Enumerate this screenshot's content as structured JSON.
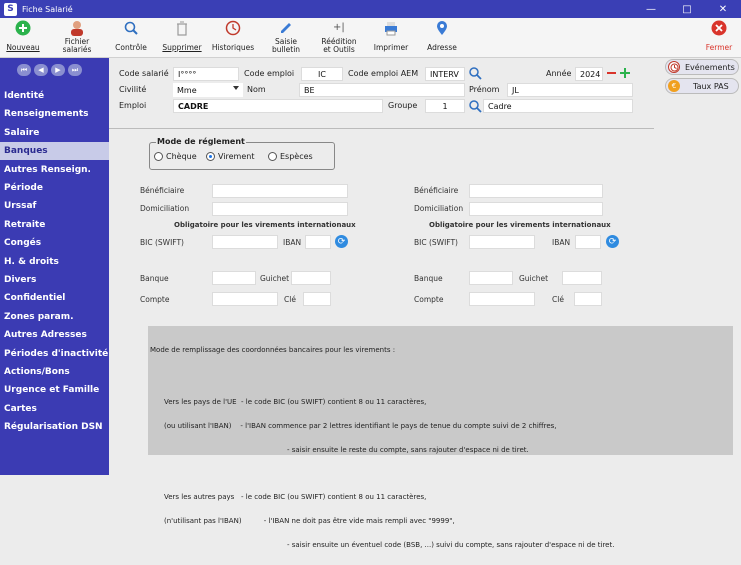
{
  "window": {
    "app_icon": "S",
    "title": "Fiche Salarié",
    "minimize": "—",
    "maximize": "□",
    "close": "✕"
  },
  "toolbar": {
    "nouveau": "Nouveau",
    "fichier_1": "Fichier",
    "fichier_2": "salariés",
    "controle": "Contrôle",
    "supprimer": "Supprimer",
    "historiques": "Historiques",
    "saisie_1": "Saisie",
    "saisie_2": "bulletin",
    "reedition_1": "Réédition",
    "reedition_2": "et Outils",
    "imprimer": "Imprimer",
    "adresse": "Adresse",
    "fermer": "Fermer"
  },
  "sidebar": {
    "items": [
      "Identité",
      "Renseignements",
      "Salaire",
      "Banques",
      "Autres Renseign.",
      "Période",
      "Urssaf",
      "Retraite",
      "Congés",
      "H. & droits",
      "Divers",
      "Confidentiel",
      "Zones param.",
      "Autres Adresses",
      "Périodes d'inactivité",
      "Actions/Bons",
      "Urgence et Famille",
      "Cartes",
      "Régularisation DSN"
    ],
    "active_index": 3
  },
  "header": {
    "code_salarie_label": "Code salarié",
    "code_salarie_value": "I°°°°",
    "code_emploi_label": "Code emploi",
    "code_emploi_value": "IC",
    "code_emploi_aem_label": "Code emploi AEM",
    "code_emploi_aem_value": "INTERV",
    "annee_label": "Année",
    "annee_value": "2024",
    "civilite_label": "Civilité",
    "civilite_value": "Mme",
    "nom_label": "Nom",
    "nom_value": "BE",
    "prenom_label": "Prénom",
    "prenom_value": "JL",
    "emploi_label": "Emploi",
    "emploi_value": "CADRE",
    "groupe_label": "Groupe",
    "groupe_value": "1",
    "groupe_desc": "Cadre"
  },
  "right_buttons": {
    "evenements": "Evénements",
    "taux_pas": "Taux PAS"
  },
  "reglement": {
    "legend": "Mode de réglement",
    "options": [
      "Chèque",
      "Virement",
      "Espèces"
    ],
    "selected": "Virement"
  },
  "bank": {
    "beneficiaire": "Bénéficiaire",
    "domiciliation": "Domiciliation",
    "obligatoire": "Obligatoire pour les virements internationaux",
    "bic": "BIC (SWIFT)",
    "iban": "IBAN",
    "banque": "Banque",
    "guichet": "Guichet",
    "compte": "Compte",
    "cle": "Clé"
  },
  "info": {
    "title": "Mode de remplissage des coordonnées bancaires pour les virements :",
    "l1": "Vers les pays de l'UE  - le code BIC (ou SWIFT) contient 8 ou 11 caractères,",
    "l2": "(ou utilisant l'IBAN)    - l'IBAN commence par 2 lettres identifiant le pays de tenue du compte suivi de 2 chiffres,",
    "l3": "- saisir ensuite le reste du compte, sans rajouter d'espace ni de tiret.",
    "l4": "Vers les autres pays   - le code BIC (ou SWIFT) contient 8 ou 11 caractères,",
    "l5": "(n'utilisant pas l'IBAN)          - l'IBAN ne doit pas être vide mais rempli avec \"9999\",",
    "l6": "- saisir ensuite un éventuel code (BSB, ...) suivi du compte, sans rajouter d'espace ni de tiret."
  },
  "colors": {
    "sidebar": "#3b3bb3",
    "titlebar": "#3a3fb5",
    "accent": "#1a73e8",
    "close_red": "#d9342b"
  },
  "icons": [
    "plus-circle-icon",
    "person-icon",
    "search-icon",
    "trash-icon",
    "clock-icon",
    "pencil-icon",
    "tools-icon",
    "printer-icon",
    "pin-icon",
    "close-circle-icon",
    "refresh-icon",
    "euro-icon"
  ]
}
